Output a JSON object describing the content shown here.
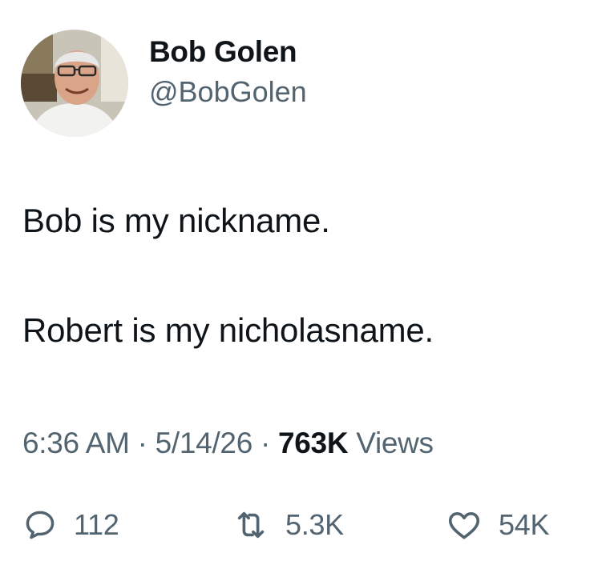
{
  "author": {
    "display_name": "Bob Golen",
    "handle": "@BobGolen",
    "avatar_icon": "profile-photo"
  },
  "tweet": {
    "paragraphs": [
      "Bob is my nickname.",
      "Robert is my nicholasname."
    ]
  },
  "meta": {
    "time": "6:36 AM",
    "separator": " · ",
    "date": "5/14/26",
    "views_count": "763K",
    "views_label": " Views"
  },
  "actions": {
    "reply": {
      "icon": "reply-icon",
      "count": "112"
    },
    "retweet": {
      "icon": "retweet-icon",
      "count": "5.3K"
    },
    "like": {
      "icon": "heart-icon",
      "count": "54K"
    }
  },
  "colors": {
    "text_primary": "#0f1419",
    "text_secondary": "#536471",
    "background": "#ffffff"
  }
}
